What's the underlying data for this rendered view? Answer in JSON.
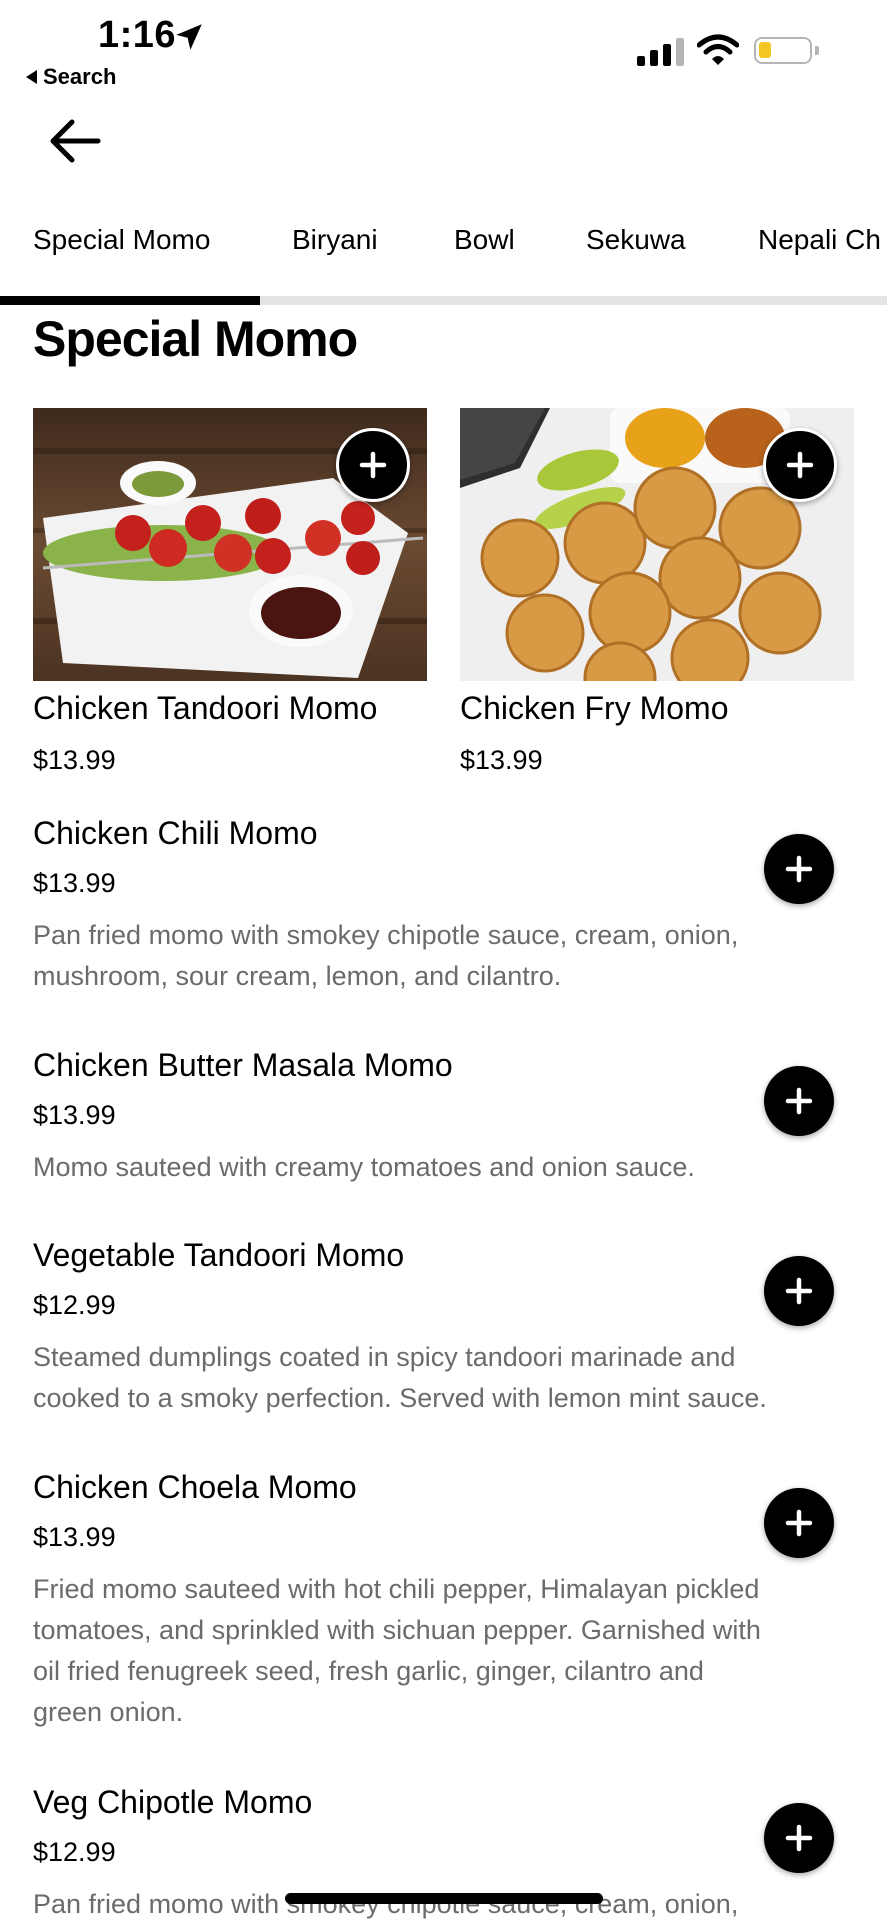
{
  "status_bar": {
    "time": "1:16",
    "back_label": "Search"
  },
  "tabs": [
    {
      "label": "Special Momo",
      "active": true
    },
    {
      "label": "Biryani"
    },
    {
      "label": "Bowl"
    },
    {
      "label": "Sekuwa"
    },
    {
      "label": "Nepali Ch"
    }
  ],
  "section": {
    "title": "Special Momo"
  },
  "featured": [
    {
      "name": "Chicken Tandoori Momo",
      "price": "$13.99"
    },
    {
      "name": "Chicken Fry Momo",
      "price": "$13.99"
    }
  ],
  "items": [
    {
      "name": "Chicken Chili Momo",
      "price": "$13.99",
      "desc1": "Pan fried momo with smokey chipotle sauce, cream, onion,",
      "desc2": "mushroom, sour cream, lemon, and cilantro."
    },
    {
      "name": "Chicken Butter Masala Momo",
      "price": "$13.99",
      "desc1": "Momo sauteed with creamy tomatoes and onion sauce."
    },
    {
      "name": "Vegetable Tandoori Momo",
      "price": "$12.99",
      "desc1": "Steamed dumplings coated in spicy tandoori marinade and",
      "desc2": "cooked to a smoky perfection. Served with lemon mint sauce."
    },
    {
      "name": "Chicken Choela Momo",
      "price": "$13.99",
      "desc1": "Fried momo sauteed with hot chili pepper, Himalayan pickled",
      "desc2": "tomatoes, and sprinkled with sichuan pepper. Garnished with",
      "desc3": "oil fried fenugreek seed, fresh garlic, ginger, cilantro and",
      "desc4": "green onion."
    },
    {
      "name": "Veg Chipotle Momo",
      "price": "$12.99",
      "desc1": "Pan fried momo with smokey chipotle sauce, cream, onion,"
    }
  ],
  "colors": {
    "text_primary": "#000000",
    "text_secondary": "#6b6b6b",
    "battery_level": "#f3c623"
  },
  "icons": [
    "location-arrow-icon",
    "signal-icon",
    "wifi-icon",
    "battery-icon",
    "back-arrow-icon",
    "plus-icon"
  ]
}
